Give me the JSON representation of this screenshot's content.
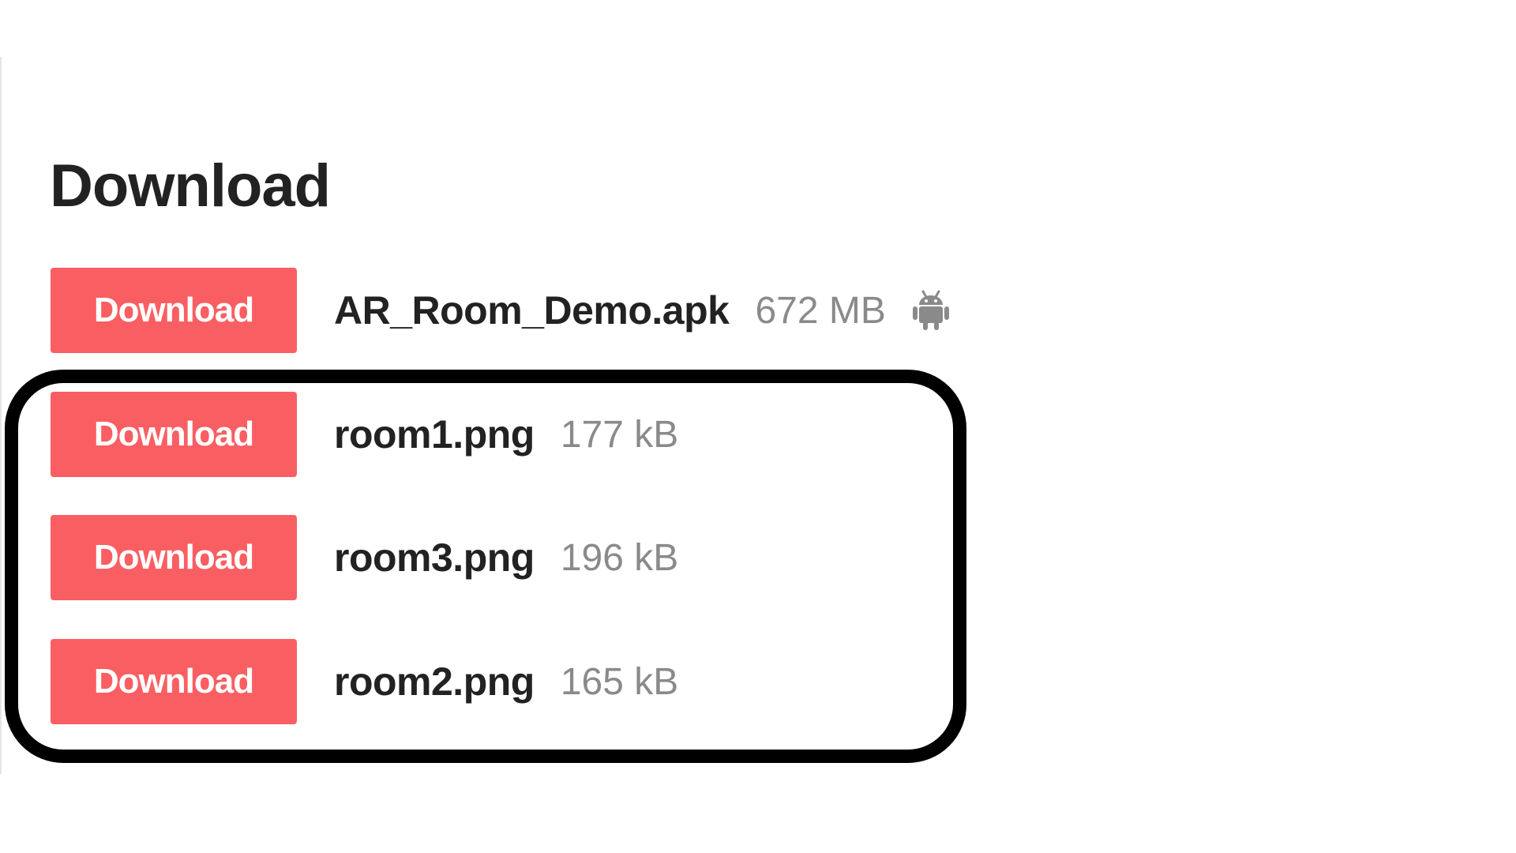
{
  "section": {
    "title": "Download"
  },
  "downloads": [
    {
      "button_label": "Download",
      "file_name": "AR_Room_Demo.apk",
      "file_size": "672 MB",
      "platform_icon": "android-icon"
    },
    {
      "button_label": "Download",
      "file_name": "room1.png",
      "file_size": "177 kB"
    },
    {
      "button_label": "Download",
      "file_name": "room3.png",
      "file_size": "196 kB"
    },
    {
      "button_label": "Download",
      "file_name": "room2.png",
      "file_size": "165 kB"
    }
  ],
  "colors": {
    "button_bg": "#f95f62",
    "button_text": "#ffffff",
    "title_text": "#222222",
    "size_text": "#8a8a8a",
    "highlight_border": "#000000",
    "icon": "#8a8a8a"
  }
}
